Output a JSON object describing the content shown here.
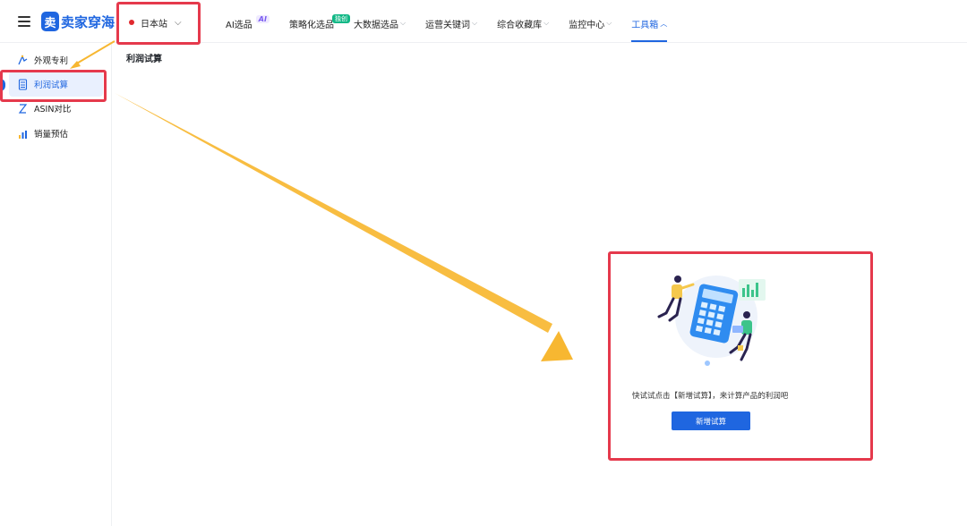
{
  "header": {
    "logo_mark": "卖",
    "logo_text": "卖家穿海",
    "site": "日本站",
    "nav": [
      {
        "label": "AI选品",
        "badge": "AI",
        "chevron": false
      },
      {
        "label": "策略化选品",
        "badge": "独创",
        "chevron": false
      },
      {
        "label": "大数据选品",
        "chevron": true
      },
      {
        "label": "运营关键词",
        "chevron": true
      },
      {
        "label": "综合收藏库",
        "chevron": true
      },
      {
        "label": "监控中心",
        "chevron": true
      },
      {
        "label": "工具箱",
        "chevron": true,
        "active": true
      }
    ]
  },
  "sidebar": {
    "items": [
      {
        "label": "外观专利",
        "icon": "patent-icon",
        "active": false
      },
      {
        "label": "利润试算",
        "icon": "calculator-icon",
        "active": true
      },
      {
        "label": "ASIN对比",
        "icon": "compare-icon",
        "active": false
      },
      {
        "label": "销量预估",
        "icon": "bar-chart-icon",
        "active": false
      }
    ]
  },
  "main": {
    "title": "利润试算",
    "empty_message": "快试试点击【新增试算】，来计算产品的利润吧",
    "new_button": "新增试算"
  },
  "colors": {
    "accent": "#1f66e0",
    "annotation": "#e5394c",
    "arrow": "#f7b731"
  }
}
